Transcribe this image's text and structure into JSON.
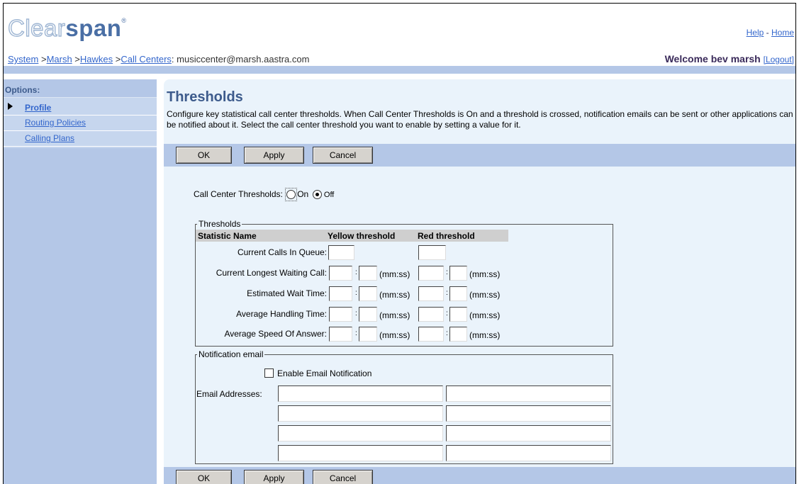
{
  "brand": {
    "clear": "Clear",
    "span": "span",
    "mark": "®"
  },
  "toplinks": {
    "help": "Help",
    "sep": " - ",
    "home": "Home"
  },
  "breadcrumb": {
    "items": [
      "System",
      "Marsh",
      "Hawkes",
      "Call Centers"
    ],
    "seps": [
      " >",
      " >",
      " >"
    ],
    "current": ": musiccenter@marsh.aastra.com"
  },
  "welcome": {
    "text": "Welcome bev marsh ",
    "logout": "[Logout]"
  },
  "sidebar": {
    "header": "Options:",
    "items": [
      {
        "label": "Profile",
        "active": true
      },
      {
        "label": "Routing Policies",
        "active": false
      },
      {
        "label": "Calling Plans",
        "active": false
      }
    ]
  },
  "page": {
    "title": "Thresholds",
    "description": "Configure key statistical call center thresholds. When Call Center Thresholds is On and a threshold is crossed, notification emails can be sent or other applications can be notified about it. Select the call center threshold you want to enable by setting a value for it."
  },
  "buttons": {
    "ok": "OK",
    "apply": "Apply",
    "cancel": "Cancel"
  },
  "toggle": {
    "label": "Call Center Thresholds:",
    "on": "On",
    "off": "Off",
    "selected": "off"
  },
  "thresholds": {
    "legend": "Thresholds",
    "columns": [
      "Statistic Name",
      "Yellow threshold",
      "Red threshold"
    ],
    "unit": "(mm:ss)",
    "colon": ":",
    "rows": [
      {
        "label": "Current Calls In Queue:",
        "type": "count"
      },
      {
        "label": "Current Longest Waiting Call:",
        "type": "time"
      },
      {
        "label": "Estimated Wait Time:",
        "type": "time"
      },
      {
        "label": "Average Handling Time:",
        "type": "time"
      },
      {
        "label": "Average Speed Of Answer:",
        "type": "time"
      }
    ]
  },
  "notification": {
    "legend": "Notification email",
    "enable_label": "Enable Email Notification",
    "enabled": false,
    "addresses_label": "Email Addresses:"
  }
}
